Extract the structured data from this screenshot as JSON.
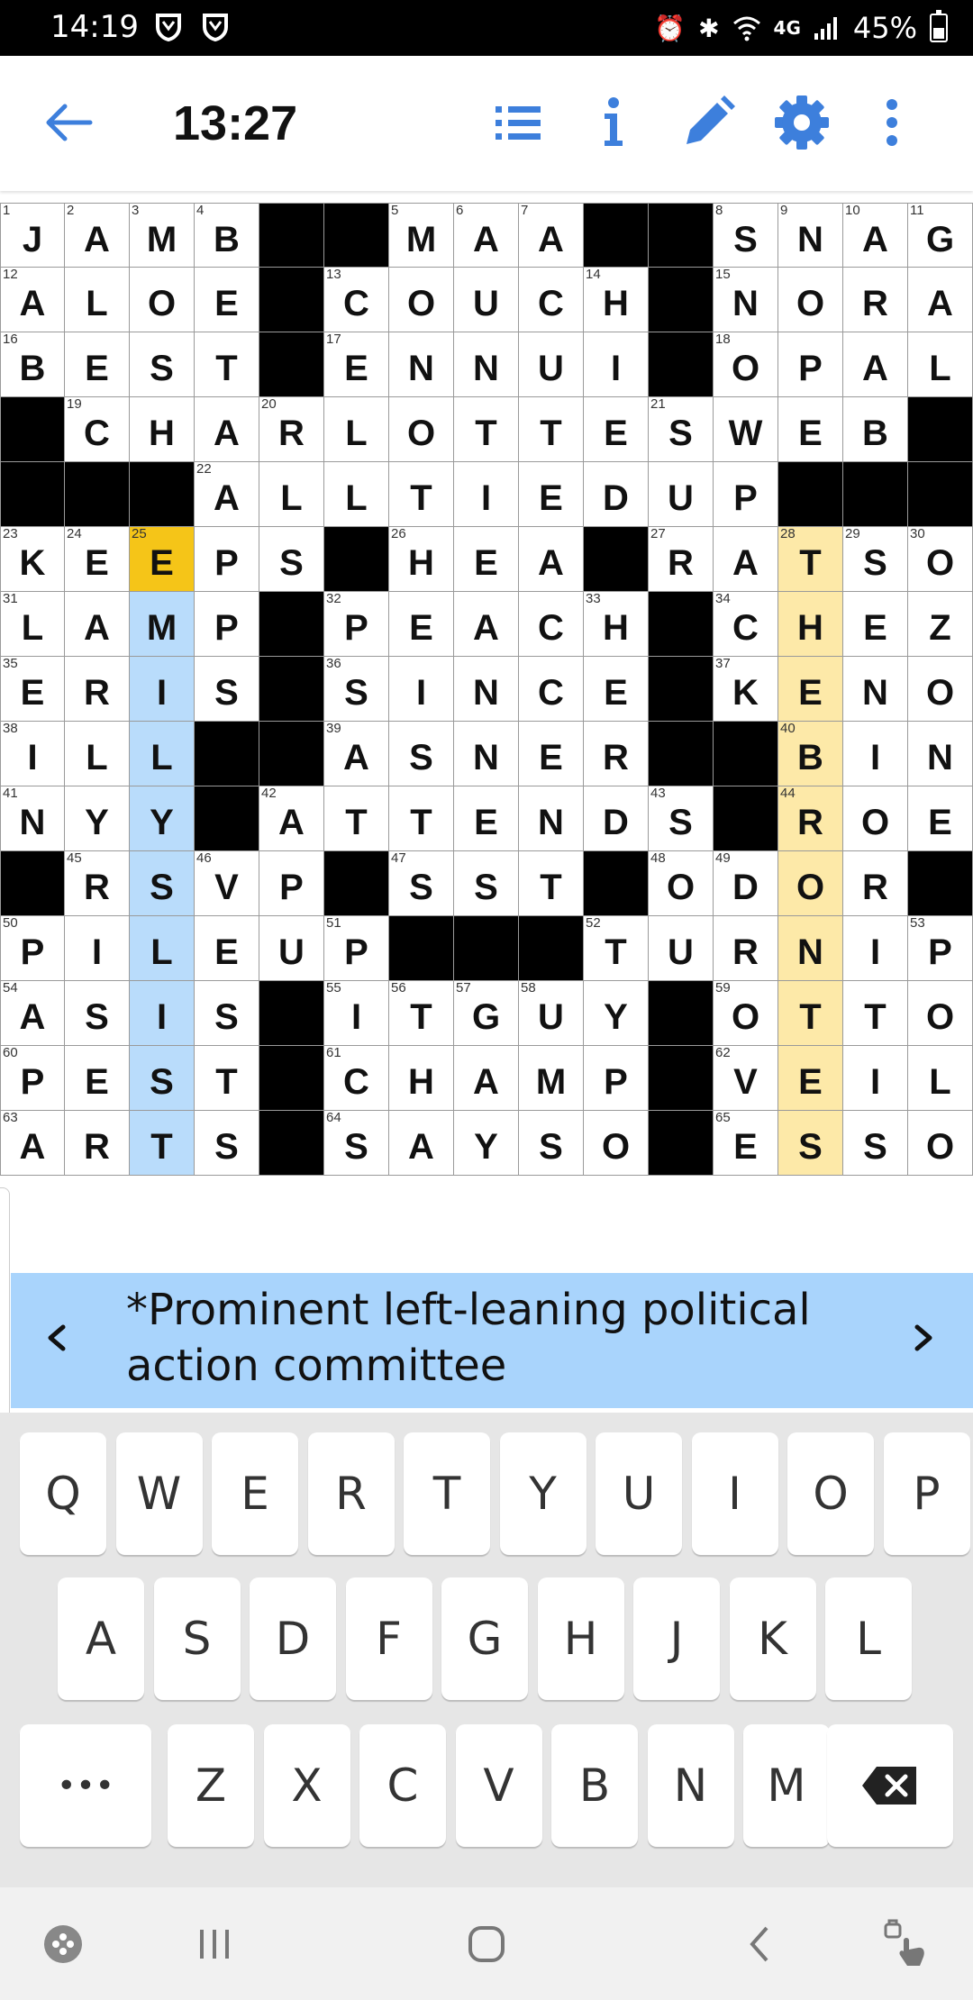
{
  "status_bar": {
    "time": "14:19",
    "network": "4G",
    "battery_percent": "45%",
    "icons": [
      "shield-icon",
      "shield-icon",
      "alarm-icon",
      "bluetooth-icon",
      "wifi-icon",
      "signal-icon",
      "battery-icon"
    ]
  },
  "toolbar": {
    "timer": "13:27",
    "icons": [
      "back-arrow-icon",
      "list-icon",
      "info-icon",
      "pencil-icon",
      "gear-icon",
      "more-vert-icon"
    ],
    "accent_color": "#3d7fdc"
  },
  "grid": {
    "rows": [
      "JAMB##MAA##SNAG",
      "ALOE#COUCH#NORA",
      "BEST#ENNUI#OPAL",
      "#CHARLOTTESWEB#",
      "###ALLTIEDUP###",
      "KEEPS#HEA#RATSO",
      "LAMP#PEACH#CHEZ",
      "ERIS#SINCE#KENO",
      "ILL##ASNER##BIN",
      "NYY#ATTENDS#ROE",
      "#RSVP#SST#ODOR#",
      "PILEUP###TURNIP",
      "ASIS#ITGUY#OTTO",
      "PEST#CHAMP#VEIL",
      "ARTS#SAYSO#ESSO"
    ],
    "numbers": [
      [
        0,
        0,
        "1"
      ],
      [
        0,
        1,
        "2"
      ],
      [
        0,
        2,
        "3"
      ],
      [
        0,
        3,
        "4"
      ],
      [
        0,
        6,
        "5"
      ],
      [
        0,
        7,
        "6"
      ],
      [
        0,
        8,
        "7"
      ],
      [
        0,
        11,
        "8"
      ],
      [
        0,
        12,
        "9"
      ],
      [
        0,
        13,
        "10"
      ],
      [
        0,
        14,
        "11"
      ],
      [
        1,
        0,
        "12"
      ],
      [
        1,
        5,
        "13"
      ],
      [
        1,
        9,
        "14"
      ],
      [
        1,
        11,
        "15"
      ],
      [
        2,
        0,
        "16"
      ],
      [
        2,
        5,
        "17"
      ],
      [
        2,
        11,
        "18"
      ],
      [
        3,
        1,
        "19"
      ],
      [
        3,
        4,
        "20"
      ],
      [
        3,
        10,
        "21"
      ],
      [
        4,
        3,
        "22"
      ],
      [
        5,
        0,
        "23"
      ],
      [
        5,
        1,
        "24"
      ],
      [
        5,
        2,
        "25"
      ],
      [
        5,
        6,
        "26"
      ],
      [
        5,
        10,
        "27"
      ],
      [
        5,
        12,
        "28"
      ],
      [
        5,
        13,
        "29"
      ],
      [
        5,
        14,
        "30"
      ],
      [
        6,
        0,
        "31"
      ],
      [
        6,
        5,
        "32"
      ],
      [
        6,
        9,
        "33"
      ],
      [
        6,
        11,
        "34"
      ],
      [
        7,
        0,
        "35"
      ],
      [
        7,
        5,
        "36"
      ],
      [
        7,
        11,
        "37"
      ],
      [
        8,
        0,
        "38"
      ],
      [
        8,
        5,
        "39"
      ],
      [
        8,
        12,
        "40"
      ],
      [
        9,
        0,
        "41"
      ],
      [
        9,
        4,
        "42"
      ],
      [
        9,
        10,
        "43"
      ],
      [
        9,
        12,
        "44"
      ],
      [
        10,
        1,
        "45"
      ],
      [
        10,
        3,
        "46"
      ],
      [
        10,
        6,
        "47"
      ],
      [
        10,
        10,
        "48"
      ],
      [
        10,
        11,
        "49"
      ],
      [
        11,
        0,
        "50"
      ],
      [
        11,
        5,
        "51"
      ],
      [
        11,
        9,
        "52"
      ],
      [
        11,
        14,
        "53"
      ],
      [
        12,
        0,
        "54"
      ],
      [
        12,
        5,
        "55"
      ],
      [
        12,
        6,
        "56"
      ],
      [
        12,
        7,
        "57"
      ],
      [
        12,
        8,
        "58"
      ],
      [
        12,
        11,
        "59"
      ],
      [
        13,
        0,
        "60"
      ],
      [
        13,
        5,
        "61"
      ],
      [
        13,
        11,
        "62"
      ],
      [
        14,
        0,
        "63"
      ],
      [
        14,
        5,
        "64"
      ],
      [
        14,
        11,
        "65"
      ]
    ],
    "cursor": [
      5,
      2
    ],
    "selected_word": {
      "col": 2,
      "rows": [
        6,
        14
      ]
    },
    "referenced_word": {
      "col": 12,
      "rows": [
        5,
        14
      ]
    },
    "colors": {
      "cursor": "#f5c518",
      "selected": "#b9dcfb",
      "referenced": "#fde9a8"
    }
  },
  "clue_bar": {
    "text": "*Prominent left-leaning political action committee",
    "prev_icon": "chevron-left-icon",
    "next_icon": "chevron-right-icon",
    "background": "#a9d4fc"
  },
  "keyboard": {
    "row1": [
      "Q",
      "W",
      "E",
      "R",
      "T",
      "Y",
      "U",
      "I",
      "O",
      "P"
    ],
    "row2": [
      "A",
      "S",
      "D",
      "F",
      "G",
      "H",
      "J",
      "K",
      "L"
    ],
    "row3": [
      "Z",
      "X",
      "C",
      "V",
      "B",
      "N",
      "M"
    ],
    "more_key": "•••",
    "backspace_icon": "backspace-icon"
  },
  "nav_bar": {
    "icons": [
      "game-icon",
      "recent-apps-icon",
      "home-icon",
      "back-icon",
      "accessibility-icon"
    ]
  }
}
